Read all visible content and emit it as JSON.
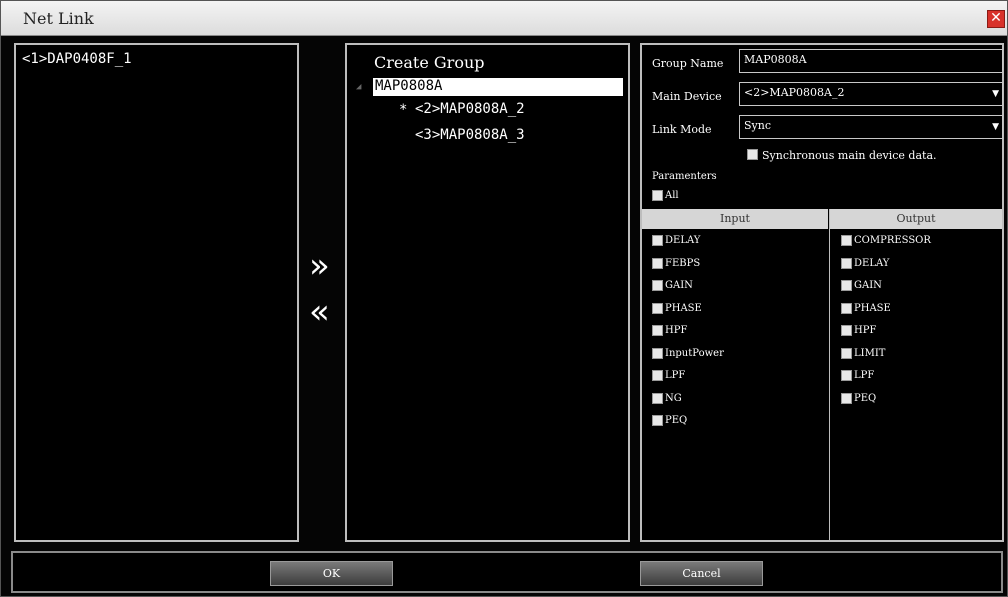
{
  "window": {
    "title": "Net Link",
    "close_glyph": "✕"
  },
  "device_list": {
    "items": [
      "<1>DAP0408F_1"
    ]
  },
  "transfer": {
    "add_glyph": "»",
    "remove_glyph": "«"
  },
  "group_tree": {
    "header": "Create Group",
    "group": "MAP0808A",
    "collapse_glyph": "◢",
    "children": [
      {
        "marker": "*",
        "label": "<2>MAP0808A_2"
      },
      {
        "marker": "",
        "label": "<3>MAP0808A_3"
      }
    ]
  },
  "settings": {
    "group_name_label": "Group Name",
    "group_name_value": "MAP0808A",
    "main_device_label": "Main Device",
    "main_device_value": "<2>MAP0808A_2",
    "link_mode_label": "Link Mode",
    "link_mode_value": "Sync",
    "sync_checkbox_label": "Synchronous main device data.",
    "parameters_label": "Paramenters",
    "all_label": "All",
    "input_header": "Input",
    "output_header": "Output",
    "input_params": [
      "DELAY",
      "FEBPS",
      "GAIN",
      "PHASE",
      "HPF",
      "InputPower",
      "LPF",
      "NG",
      "PEQ"
    ],
    "output_params": [
      "COMPRESSOR",
      "DELAY",
      "GAIN",
      "PHASE",
      "HPF",
      "LIMIT",
      "LPF",
      "PEQ"
    ]
  },
  "buttons": {
    "ok": "OK",
    "cancel": "Cancel"
  },
  "colors": {
    "background": "#050505",
    "panel_border": "#bdbdbd",
    "close": "#d8312a"
  }
}
